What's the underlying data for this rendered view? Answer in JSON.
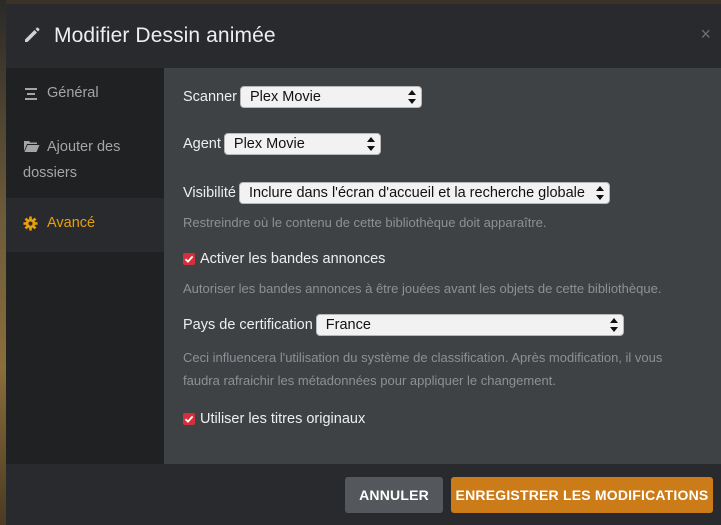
{
  "header": {
    "title": "Modifier Dessin animée",
    "close_symbol": "×",
    "edit_icon": "pencil-icon"
  },
  "sidebar": {
    "items": [
      {
        "label": "Général",
        "icon": "list-icon",
        "active": false
      },
      {
        "label": "Ajouter des dossiers",
        "icon": "folder-icon",
        "active": false
      },
      {
        "label": "Avancé",
        "icon": "gear-icon",
        "active": true
      }
    ]
  },
  "form": {
    "scanner": {
      "label": "Scanner",
      "value": "Plex Movie"
    },
    "agent": {
      "label": "Agent",
      "value": "Plex Movie"
    },
    "visibility": {
      "label": "Visibilité",
      "value": "Inclure dans l'écran d'accueil et la recherche globale",
      "help": "Restreindre où le contenu de cette bibliothèque doit apparaître."
    },
    "trailers": {
      "label": "Activer les bandes annonces",
      "checked": true,
      "help": "Autoriser les bandes annonces à être jouées avant les objets de cette bibliothèque."
    },
    "certification": {
      "label": "Pays de certification",
      "value": "France",
      "help_line1": "Ceci influencera l'utilisation du système de classification. Après modification, il vous",
      "help_line2": "faudra rafraichir les métadonnées pour appliquer le changement."
    },
    "original_titles": {
      "label": "Utiliser les titres originaux",
      "checked": true
    }
  },
  "footer": {
    "cancel_label": "ANNULER",
    "save_label": "ENREGISTRER LES MODIFICATIONS"
  },
  "colors": {
    "accent": "#e5a00d",
    "save_button": "#cc7b19",
    "checkbox": "#d62f3c"
  }
}
